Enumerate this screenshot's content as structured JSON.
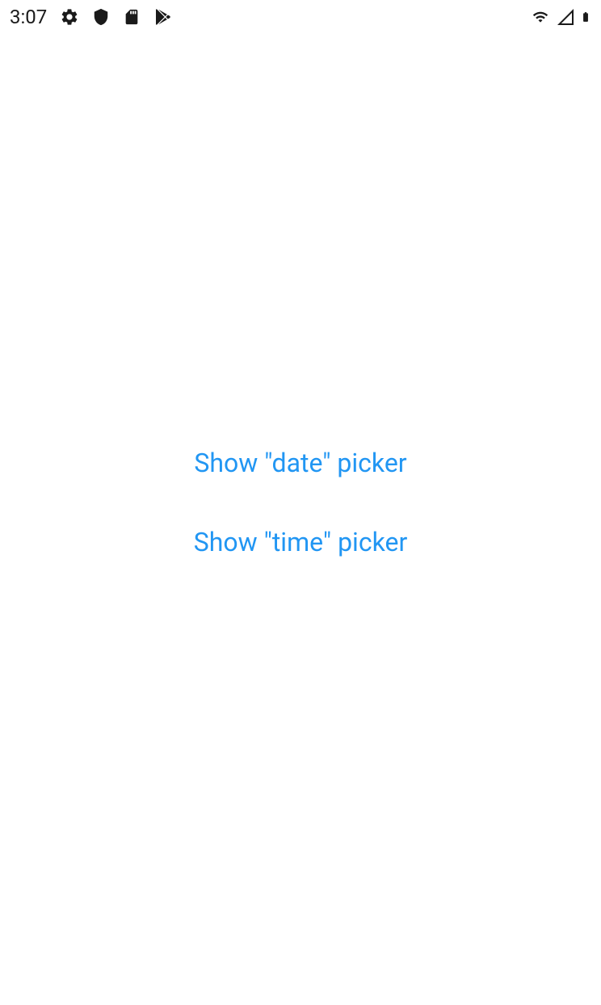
{
  "status_bar": {
    "time": "3:07",
    "icons": {
      "settings": "gear-icon",
      "shield": "shield-icon",
      "sd_card": "sd-card-icon",
      "play": "play-store-icon",
      "wifi": "wifi-icon",
      "signal": "cell-signal-icon",
      "battery": "battery-icon"
    }
  },
  "main": {
    "date_picker_label": "Show \"date\" picker",
    "time_picker_label": "Show \"time\" picker"
  },
  "colors": {
    "link": "#2196F3",
    "status_fg": "#1a1a1a",
    "background": "#ffffff"
  }
}
